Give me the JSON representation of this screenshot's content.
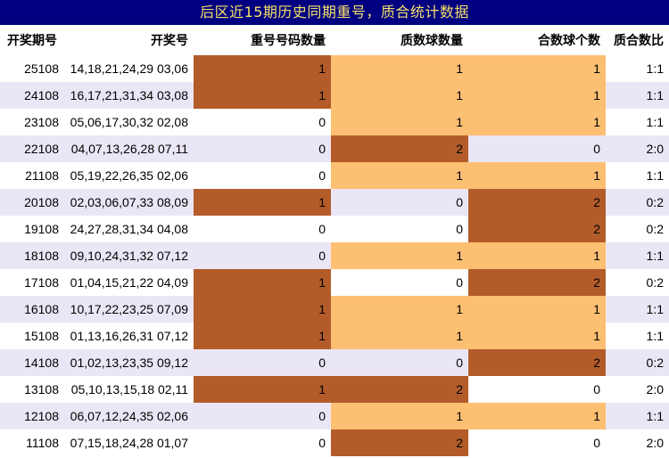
{
  "title": "后区近15期历史同期重号，质合统计数据",
  "columns": [
    "开奖期号",
    "开奖号",
    "重号号码数量",
    "质数球数量",
    "合数球个数",
    "质合数比"
  ],
  "colors": {
    "header_bg": "#000080",
    "header_text": "#f5e06b",
    "dark": "#b35c2a",
    "light": "#fdbf72",
    "stripe": "#ebe6f5"
  },
  "rows": [
    {
      "issue": "25108",
      "numbers": "14,18,21,24,29 03,06",
      "repeat": "1",
      "prime": "1",
      "composite": "1",
      "ratio": "1:1",
      "h": [
        "dark",
        "light",
        "light"
      ]
    },
    {
      "issue": "24108",
      "numbers": "16,17,21,31,34 03,08",
      "repeat": "1",
      "prime": "1",
      "composite": "1",
      "ratio": "1:1",
      "h": [
        "dark",
        "light",
        "light"
      ]
    },
    {
      "issue": "23108",
      "numbers": "05,06,17,30,32 02,08",
      "repeat": "0",
      "prime": "1",
      "composite": "1",
      "ratio": "1:1",
      "h": [
        "",
        "light",
        "light"
      ]
    },
    {
      "issue": "22108",
      "numbers": "04,07,13,26,28 07,11",
      "repeat": "0",
      "prime": "2",
      "composite": "0",
      "ratio": "2:0",
      "h": [
        "",
        "dark",
        ""
      ]
    },
    {
      "issue": "21108",
      "numbers": "05,19,22,26,35 02,06",
      "repeat": "0",
      "prime": "1",
      "composite": "1",
      "ratio": "1:1",
      "h": [
        "",
        "light",
        "light"
      ]
    },
    {
      "issue": "20108",
      "numbers": "02,03,06,07,33 08,09",
      "repeat": "1",
      "prime": "0",
      "composite": "2",
      "ratio": "0:2",
      "h": [
        "dark",
        "",
        "dark"
      ]
    },
    {
      "issue": "19108",
      "numbers": "24,27,28,31,34 04,08",
      "repeat": "0",
      "prime": "0",
      "composite": "2",
      "ratio": "0:2",
      "h": [
        "",
        "",
        "dark"
      ]
    },
    {
      "issue": "18108",
      "numbers": "09,10,24,31,32 07,12",
      "repeat": "0",
      "prime": "1",
      "composite": "1",
      "ratio": "1:1",
      "h": [
        "",
        "light",
        "light"
      ]
    },
    {
      "issue": "17108",
      "numbers": "01,04,15,21,22 04,09",
      "repeat": "1",
      "prime": "0",
      "composite": "2",
      "ratio": "0:2",
      "h": [
        "dark",
        "",
        "dark"
      ]
    },
    {
      "issue": "16108",
      "numbers": "10,17,22,23,25 07,09",
      "repeat": "1",
      "prime": "1",
      "composite": "1",
      "ratio": "1:1",
      "h": [
        "dark",
        "light",
        "light"
      ]
    },
    {
      "issue": "15108",
      "numbers": "01,13,16,26,31 07,12",
      "repeat": "1",
      "prime": "1",
      "composite": "1",
      "ratio": "1:1",
      "h": [
        "dark",
        "light",
        "light"
      ]
    },
    {
      "issue": "14108",
      "numbers": "01,02,13,23,35 09,12",
      "repeat": "0",
      "prime": "0",
      "composite": "2",
      "ratio": "0:2",
      "h": [
        "",
        "",
        "dark"
      ]
    },
    {
      "issue": "13108",
      "numbers": "05,10,13,15,18 02,11",
      "repeat": "1",
      "prime": "2",
      "composite": "0",
      "ratio": "2:0",
      "h": [
        "dark",
        "dark",
        ""
      ]
    },
    {
      "issue": "12108",
      "numbers": "06,07,12,24,35 02,06",
      "repeat": "0",
      "prime": "1",
      "composite": "1",
      "ratio": "1:1",
      "h": [
        "",
        "light",
        "light"
      ]
    },
    {
      "issue": "11108",
      "numbers": "07,15,18,24,28 01,07",
      "repeat": "0",
      "prime": "2",
      "composite": "0",
      "ratio": "2:0",
      "h": [
        "",
        "dark",
        ""
      ]
    }
  ]
}
